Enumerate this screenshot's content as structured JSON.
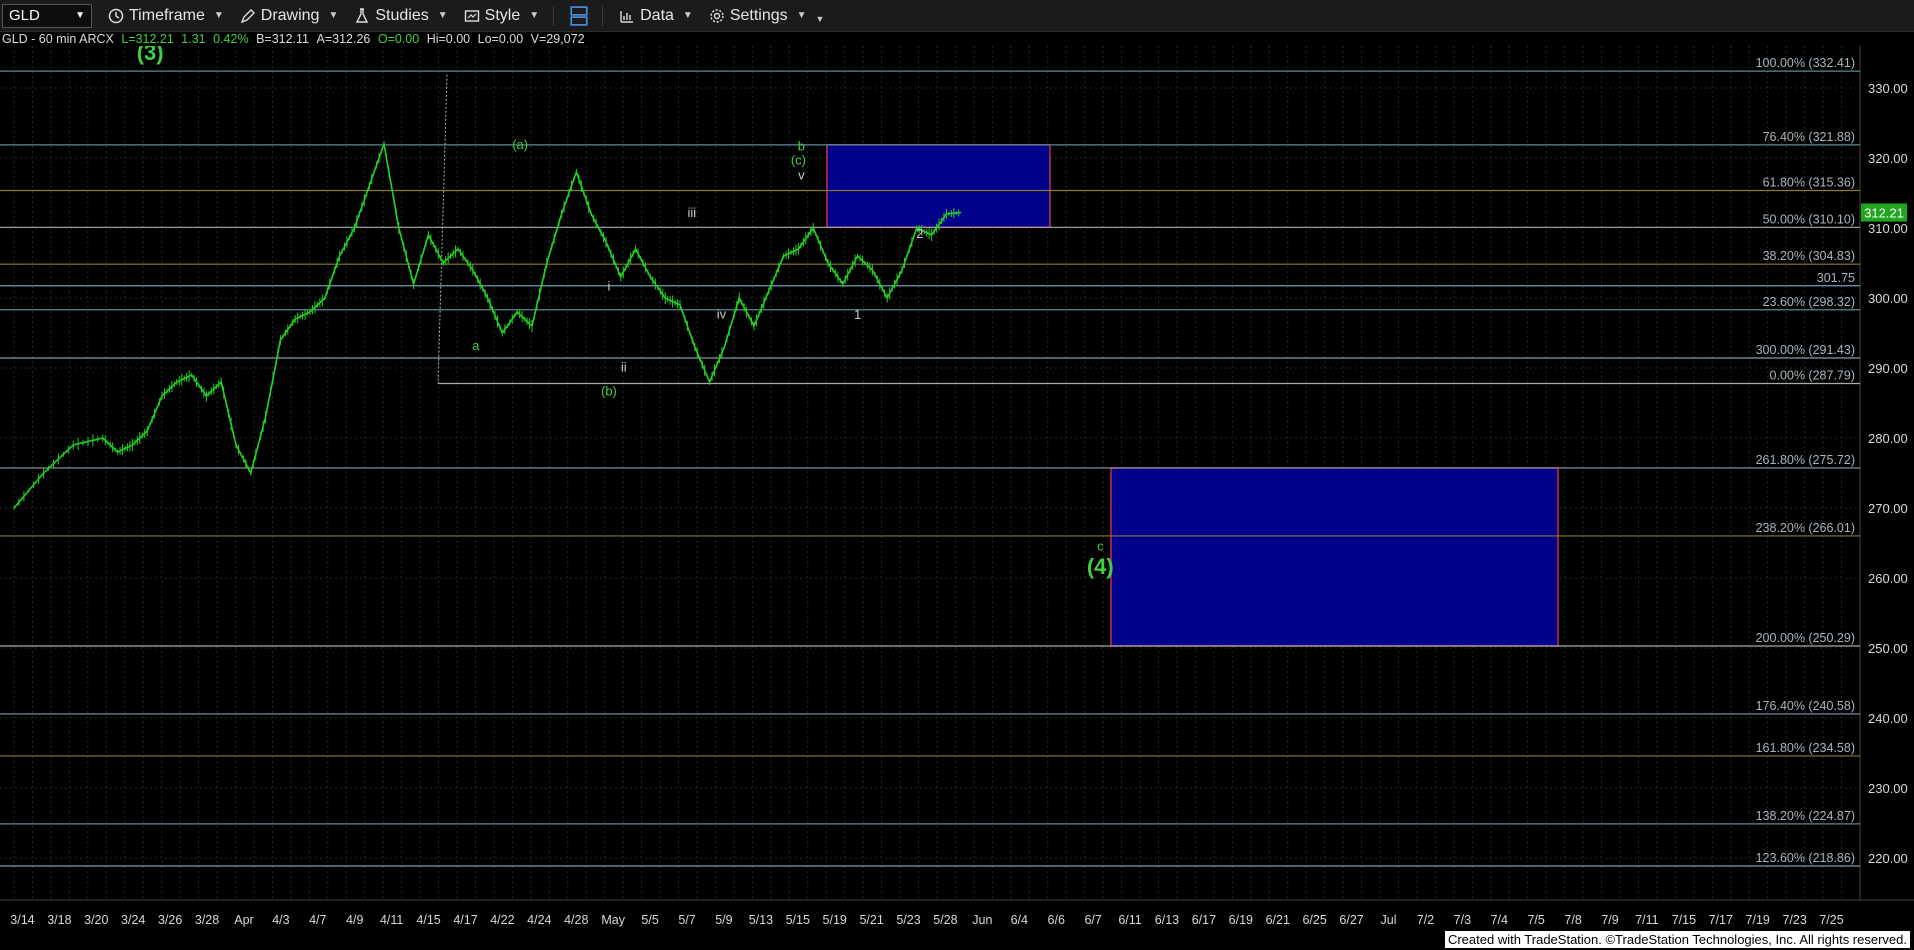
{
  "toolbar": {
    "symbol": "GLD",
    "items": [
      {
        "label": "Timeframe",
        "icon": "timeframe-icon"
      },
      {
        "label": "Drawing",
        "icon": "drawing-icon"
      },
      {
        "label": "Studies",
        "icon": "studies-icon"
      },
      {
        "label": "Style",
        "icon": "style-icon"
      },
      {
        "label": "Data",
        "icon": "data-icon"
      },
      {
        "label": "Settings",
        "icon": "settings-icon"
      }
    ]
  },
  "info": {
    "symbol_line": "GLD - 60 min  ARCX",
    "last": "L=312.21",
    "change": "1.31",
    "pct": "0.42%",
    "bid": "B=312.11",
    "ask": "A=312.26",
    "open": "O=0.00",
    "hi": "Hi=0.00",
    "lo": "Lo=0.00",
    "vol": "V=29,072"
  },
  "footer": "Created with TradeStation. ©TradeStation Technologies, Inc. All rights reserved.",
  "chart_data": {
    "type": "line",
    "title": "GLD - 60 min",
    "ylim": [
      214,
      336
    ],
    "yticks": [
      220,
      230,
      240,
      250,
      260,
      270,
      280,
      290,
      300,
      310,
      320,
      330
    ],
    "last_price": 312.21,
    "last_price_label": "312.21",
    "x_labels": [
      "3/14",
      "3/18",
      "3/20",
      "3/24",
      "3/26",
      "3/28",
      "Apr",
      "4/3",
      "4/7",
      "4/9",
      "4/11",
      "4/15",
      "4/17",
      "4/22",
      "4/24",
      "4/28",
      "May",
      "5/5",
      "5/7",
      "5/9",
      "5/13",
      "5/15",
      "5/19",
      "5/21",
      "5/23",
      "5/28",
      "Jun",
      "6/4",
      "6/6",
      "6/7",
      "6/11",
      "6/13",
      "6/17",
      "6/19",
      "6/21",
      "6/25",
      "6/27",
      "Jul",
      "7/2",
      "7/3",
      "7/4",
      "7/5",
      "7/8",
      "7/9",
      "7/11",
      "7/15",
      "7/17",
      "7/19",
      "7/23",
      "7/25"
    ],
    "price_path": [
      [
        0,
        270
      ],
      [
        2,
        275
      ],
      [
        4,
        279
      ],
      [
        6,
        280
      ],
      [
        7,
        278
      ],
      [
        8,
        279
      ],
      [
        9,
        281
      ],
      [
        10,
        286
      ],
      [
        11,
        288
      ],
      [
        12,
        289
      ],
      [
        13,
        286
      ],
      [
        14,
        288
      ],
      [
        15,
        279
      ],
      [
        16,
        275
      ],
      [
        17,
        283
      ],
      [
        18,
        294
      ],
      [
        19,
        297
      ],
      [
        20,
        298
      ],
      [
        21,
        300
      ],
      [
        22,
        306
      ],
      [
        23,
        310
      ],
      [
        24,
        316
      ],
      [
        25,
        322
      ],
      [
        26,
        310
      ],
      [
        27,
        302
      ],
      [
        28,
        309
      ],
      [
        29,
        305
      ],
      [
        30,
        307
      ],
      [
        31,
        304
      ],
      [
        32,
        300
      ],
      [
        33,
        295
      ],
      [
        34,
        298
      ],
      [
        35,
        296
      ],
      [
        36,
        305
      ],
      [
        37,
        312
      ],
      [
        38,
        318
      ],
      [
        39,
        312
      ],
      [
        40,
        308
      ],
      [
        41,
        303
      ],
      [
        42,
        307
      ],
      [
        43,
        303
      ],
      [
        44,
        300
      ],
      [
        45,
        299
      ],
      [
        46,
        293
      ],
      [
        47,
        288
      ],
      [
        48,
        293
      ],
      [
        49,
        300
      ],
      [
        50,
        296
      ],
      [
        51,
        301
      ],
      [
        52,
        306
      ],
      [
        53,
        307
      ],
      [
        54,
        310
      ],
      [
        55,
        305
      ],
      [
        56,
        302
      ],
      [
        57,
        306
      ],
      [
        58,
        304
      ],
      [
        59,
        300
      ],
      [
        60,
        304
      ],
      [
        61,
        310
      ],
      [
        62,
        309
      ],
      [
        63,
        312
      ],
      [
        64,
        312.21
      ]
    ],
    "fib_levels": [
      {
        "label": "100.00% (332.41)",
        "value": 332.41,
        "color": "#5a8a96"
      },
      {
        "label": "76.40% (321.88)",
        "value": 321.88,
        "color": "#5a8a96"
      },
      {
        "label": "61.80% (315.36)",
        "value": 315.36,
        "color": "#8a7a30"
      },
      {
        "label": "50.00% (310.10)",
        "value": 310.1,
        "color": "#aaaaaa"
      },
      {
        "label": "38.20% (304.83)",
        "value": 304.83,
        "color": "#8a7a30"
      },
      {
        "label": "301.75",
        "value": 301.75,
        "color": "#6fa0b8"
      },
      {
        "label": "23.60% (298.32)",
        "value": 298.32,
        "color": "#5a8a96"
      },
      {
        "label": "300.00% (291.43)",
        "value": 291.43,
        "color": "#8a9aaa"
      },
      {
        "label": "0.00% (287.79)",
        "value": 287.79,
        "color": "#aaaaaa"
      },
      {
        "label": "261.80% (275.72)",
        "value": 275.72,
        "color": "#8a9aaa"
      },
      {
        "label": "238.20% (266.01)",
        "value": 266.01,
        "color": "#8a7a30"
      },
      {
        "label": "200.00% (250.29)",
        "value": 250.29,
        "color": "#aaaaaa"
      },
      {
        "label": "176.40% (240.58)",
        "value": 240.58,
        "color": "#8a9aaa"
      },
      {
        "label": "161.80% (234.58)",
        "value": 234.58,
        "color": "#8a7a30"
      },
      {
        "label": "138.20% (224.87)",
        "value": 224.87,
        "color": "#5a8a96"
      },
      {
        "label": "123.60% (218.86)",
        "value": 218.86,
        "color": "#8a9aaa"
      }
    ],
    "zones": [
      {
        "name": "b-target-box",
        "from": 310.1,
        "to": 321.88,
        "fill": "#00008b",
        "border": "#c0304a"
      },
      {
        "name": "c-target-box",
        "from": 250.29,
        "to": 275.72,
        "fill": "#00008b",
        "border": "#c0304a"
      }
    ],
    "wave_labels": [
      {
        "text": "(3)",
        "color": "#3fd03f",
        "size": "large",
        "x": 4.6,
        "y": 334.0
      },
      {
        "text": "(a)",
        "color": "#3fd03f",
        "size": "small",
        "x": 17.1,
        "y": 321.3
      },
      {
        "text": "a",
        "color": "#3fd03f",
        "size": "small",
        "x": 15.6,
        "y": 292.6
      },
      {
        "text": "(b)",
        "color": "#3fd03f",
        "size": "small",
        "x": 20.1,
        "y": 286.1
      },
      {
        "text": "i",
        "color": "#cccccc",
        "size": "small",
        "x": 20.1,
        "y": 301.1
      },
      {
        "text": "ii",
        "color": "#cccccc",
        "size": "small",
        "x": 20.6,
        "y": 289.5
      },
      {
        "text": "iii",
        "color": "#cccccc",
        "size": "small",
        "x": 22.9,
        "y": 311.6
      },
      {
        "text": "iv",
        "color": "#cccccc",
        "size": "small",
        "x": 23.9,
        "y": 297.1
      },
      {
        "text": "b",
        "color": "#3fd03f",
        "size": "small",
        "x": 26.6,
        "y": 321.1
      },
      {
        "text": "(c)",
        "color": "#3fd03f",
        "size": "small",
        "x": 26.5,
        "y": 319.1
      },
      {
        "text": "v",
        "color": "#cccccc",
        "size": "small",
        "x": 26.6,
        "y": 316.9
      },
      {
        "text": "2",
        "color": "#cccccc",
        "size": "small",
        "x": 30.6,
        "y": 308.6
      },
      {
        "text": "1",
        "color": "#cccccc",
        "size": "small",
        "x": 28.5,
        "y": 297.0
      },
      {
        "text": "c",
        "color": "#3fd03f",
        "size": "small",
        "x": 36.7,
        "y": 263.9
      },
      {
        "text": "(4)",
        "color": "#3fd03f",
        "size": "large",
        "x": 36.7,
        "y": 260.6
      }
    ],
    "grid": true,
    "legend": "none"
  }
}
